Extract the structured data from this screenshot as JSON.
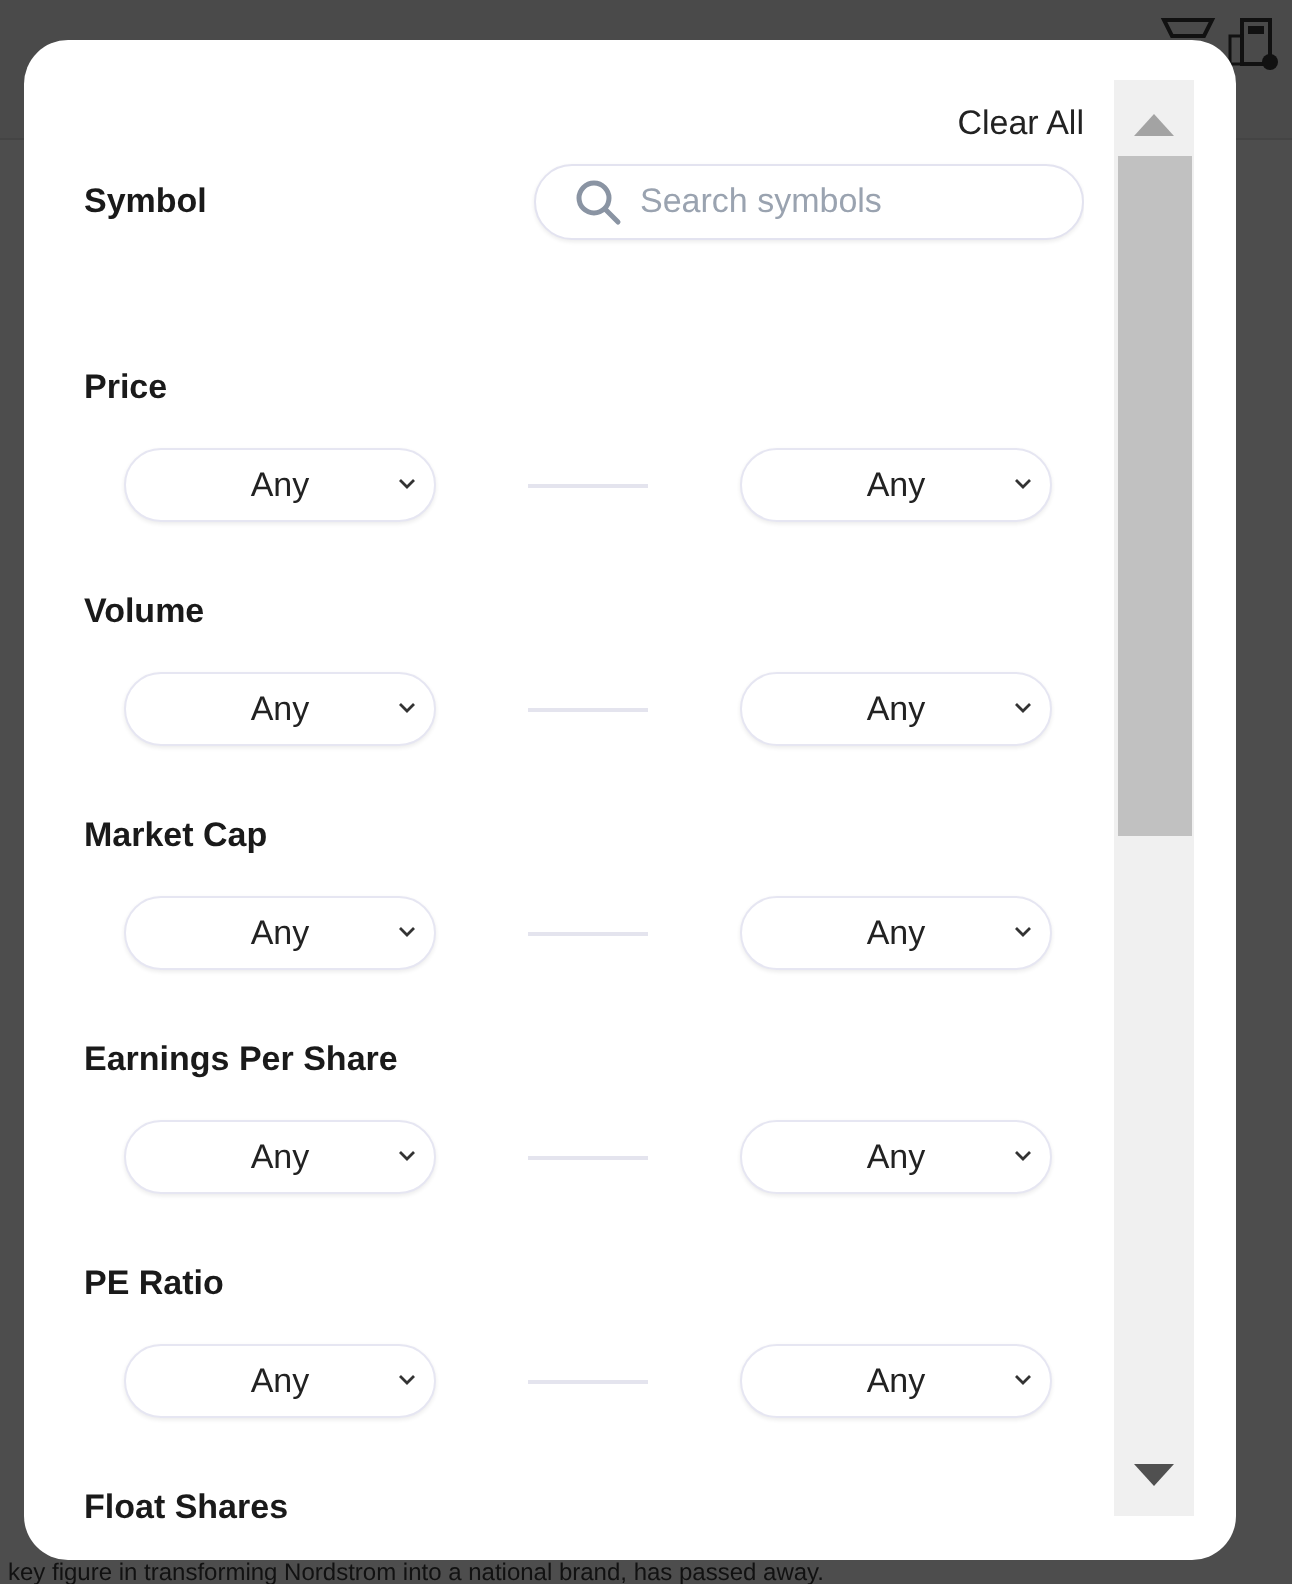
{
  "background": {
    "caption": "key figure in transforming Nordstrom into a national brand, has passed away."
  },
  "filter_dialog": {
    "clear_all": "Clear All",
    "symbol": {
      "label": "Symbol",
      "placeholder": "Search symbols"
    },
    "filters": [
      {
        "label": "Price",
        "min": "Any",
        "max": "Any"
      },
      {
        "label": "Volume",
        "min": "Any",
        "max": "Any"
      },
      {
        "label": "Market Cap",
        "min": "Any",
        "max": "Any"
      },
      {
        "label": "Earnings Per Share",
        "min": "Any",
        "max": "Any"
      },
      {
        "label": "PE Ratio",
        "min": "Any",
        "max": "Any"
      },
      {
        "label": "Float Shares"
      }
    ]
  }
}
